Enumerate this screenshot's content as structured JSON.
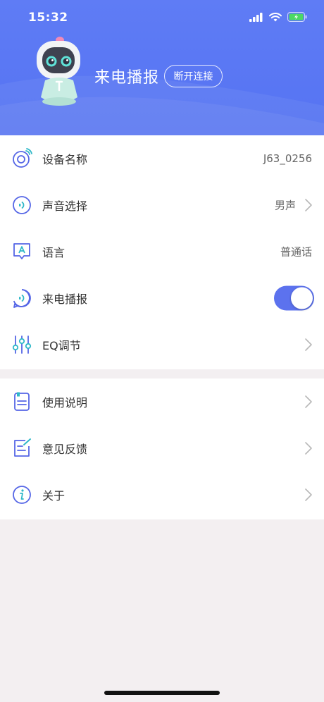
{
  "status_bar": {
    "time": "15:32"
  },
  "header": {
    "title": "来电播报",
    "disconnect_label": "断开连接"
  },
  "settings": [
    {
      "label": "设备名称",
      "value": "J63_0256",
      "icon": "device-icon"
    },
    {
      "label": "声音选择",
      "value": "男声",
      "icon": "sound-icon"
    },
    {
      "label": "语言",
      "value": "普通话",
      "icon": "language-icon"
    },
    {
      "label": "来电播报",
      "toggle_on": true,
      "icon": "call-announce-icon"
    },
    {
      "label": "EQ调节",
      "icon": "eq-icon"
    }
  ],
  "more": [
    {
      "label": "使用说明",
      "icon": "manual-icon"
    },
    {
      "label": "意见反馈",
      "icon": "feedback-icon"
    },
    {
      "label": "关于",
      "icon": "info-icon"
    }
  ],
  "colors": {
    "header": "#5f7cf5",
    "accent": "#5c72ee",
    "background": "#f3eff1"
  }
}
